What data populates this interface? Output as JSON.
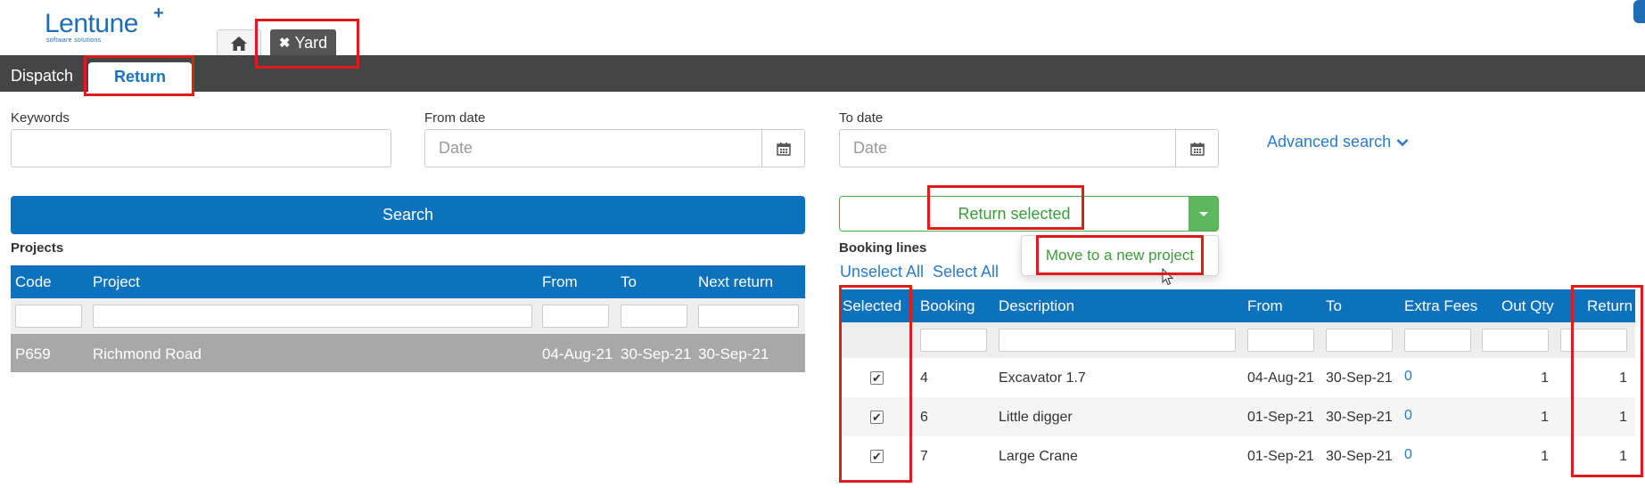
{
  "logo": {
    "text": "Lentune",
    "plus": "+",
    "tagline": "software solutions"
  },
  "top_tabs": {
    "home_icon": "home-icon",
    "yard_label": "Yard",
    "yard_close": "✖"
  },
  "nav": {
    "dispatch": "Dispatch",
    "return": "Return"
  },
  "filters": {
    "keywords_label": "Keywords",
    "keywords_value": "",
    "from_label": "From date",
    "from_placeholder": "Date",
    "to_label": "To date",
    "to_placeholder": "Date",
    "advanced_search": "Advanced search"
  },
  "search_button": "Search",
  "actions": {
    "return_selected": "Return selected",
    "move_to_new_project": "Move to a new project"
  },
  "projects": {
    "title": "Projects",
    "columns": [
      "Code",
      "Project",
      "From",
      "To",
      "Next return"
    ],
    "rows": [
      {
        "code": "P659",
        "project": "Richmond Road",
        "from": "04-Aug-21",
        "to": "30-Sep-21",
        "next_return": "30-Sep-21"
      }
    ]
  },
  "booking_lines": {
    "title": "Booking lines",
    "unselect_all": "Unselect All",
    "select_all": "Select All",
    "columns": [
      "Selected",
      "Booking",
      "Description",
      "From",
      "To",
      "Extra Fees",
      "Out Qty",
      "Return"
    ],
    "rows": [
      {
        "selected": true,
        "booking": "4",
        "description": "Excavator 1.7",
        "from": "04-Aug-21",
        "to": "30-Sep-21",
        "extra_fees": "0",
        "out_qty": "1",
        "return": "1"
      },
      {
        "selected": true,
        "booking": "6",
        "description": "Little digger",
        "from": "01-Sep-21",
        "to": "30-Sep-21",
        "extra_fees": "0",
        "out_qty": "1",
        "return": "1"
      },
      {
        "selected": true,
        "booking": "7",
        "description": "Large Crane",
        "from": "01-Sep-21",
        "to": "30-Sep-21",
        "extra_fees": "0",
        "out_qty": "1",
        "return": "1"
      }
    ]
  },
  "colors": {
    "primary": "#0d72bd",
    "navbar": "#454545",
    "success": "#5cb85c",
    "annotation": "#e31a1a",
    "selected_row": "#a8a8a8"
  }
}
